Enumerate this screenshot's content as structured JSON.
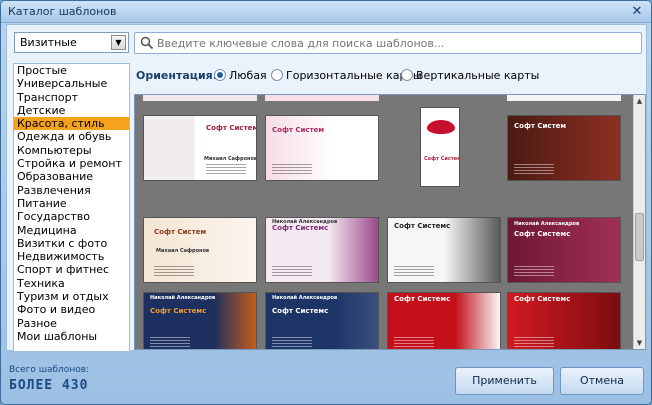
{
  "window": {
    "title": "Каталог шаблонов"
  },
  "dropdown": {
    "value": "Визитные"
  },
  "categories": [
    {
      "label": "Простые"
    },
    {
      "label": "Универсальные"
    },
    {
      "label": "Транспорт"
    },
    {
      "label": "Детские"
    },
    {
      "label": "Красота, стиль",
      "selected": true
    },
    {
      "label": "Одежда и обувь"
    },
    {
      "label": "Компьютеры"
    },
    {
      "label": "Стройка и ремонт"
    },
    {
      "label": "Образование"
    },
    {
      "label": "Развлечения"
    },
    {
      "label": "Питание"
    },
    {
      "label": "Государство"
    },
    {
      "label": "Медицина"
    },
    {
      "label": "Визитки с фото"
    },
    {
      "label": "Недвижимость"
    },
    {
      "label": "Спорт и фитнес"
    },
    {
      "label": "Техника"
    },
    {
      "label": "Туризм и отдых"
    },
    {
      "label": "Фото и видео"
    },
    {
      "label": "Разное"
    },
    {
      "label": "Мои шаблоны"
    }
  ],
  "search": {
    "placeholder": "Введите ключевые слова для поиска шаблонов..."
  },
  "orientation": {
    "label": "Ориентация:",
    "options": [
      {
        "label": "Любая",
        "checked": true
      },
      {
        "label": "Горизонтальные карты",
        "checked": false
      },
      {
        "label": "Вертикальные карты",
        "checked": false
      }
    ]
  },
  "templates": [
    {
      "name": "Софт Систем",
      "person": "Михаил Сафронов",
      "theme": "cosmetics-light"
    },
    {
      "name": "Софт Систем",
      "person": "",
      "theme": "pink-script"
    },
    {
      "name": "Софт Систем",
      "person": "",
      "theme": "lips-vertical"
    },
    {
      "name": "Софт Систем",
      "person": "",
      "theme": "dark-brown"
    },
    {
      "name": "Софт Систем",
      "person": "Михаил Сафронов",
      "theme": "cream-floral"
    },
    {
      "name": "Софт Системс",
      "person": "Николай Александров",
      "theme": "purple-woman"
    },
    {
      "name": "Софт Системс",
      "person": "",
      "theme": "bw-woman"
    },
    {
      "name": "Софт Системс",
      "person": "Николай Александров",
      "theme": "maroon-makeup"
    },
    {
      "name": "Софт Системс",
      "person": "Николай Александров",
      "theme": "navy-orange"
    },
    {
      "name": "Софт Системс",
      "person": "Николай Александров",
      "theme": "navy-dancer"
    },
    {
      "name": "Софт Системс",
      "person": "",
      "theme": "red-white"
    },
    {
      "name": "Софт Системс",
      "person": "",
      "theme": "red-woman"
    }
  ],
  "footer": {
    "count_label": "Всего шаблонов:",
    "count_value": "БОЛЕЕ 430",
    "apply_label": "Применить",
    "cancel_label": "Отмена"
  },
  "colors": {
    "selection": "#f5a21d",
    "accent": "#1f5ea5"
  },
  "icons": {
    "search": "search-icon",
    "close": "close-icon",
    "dropdown": "chevron-down-icon"
  }
}
